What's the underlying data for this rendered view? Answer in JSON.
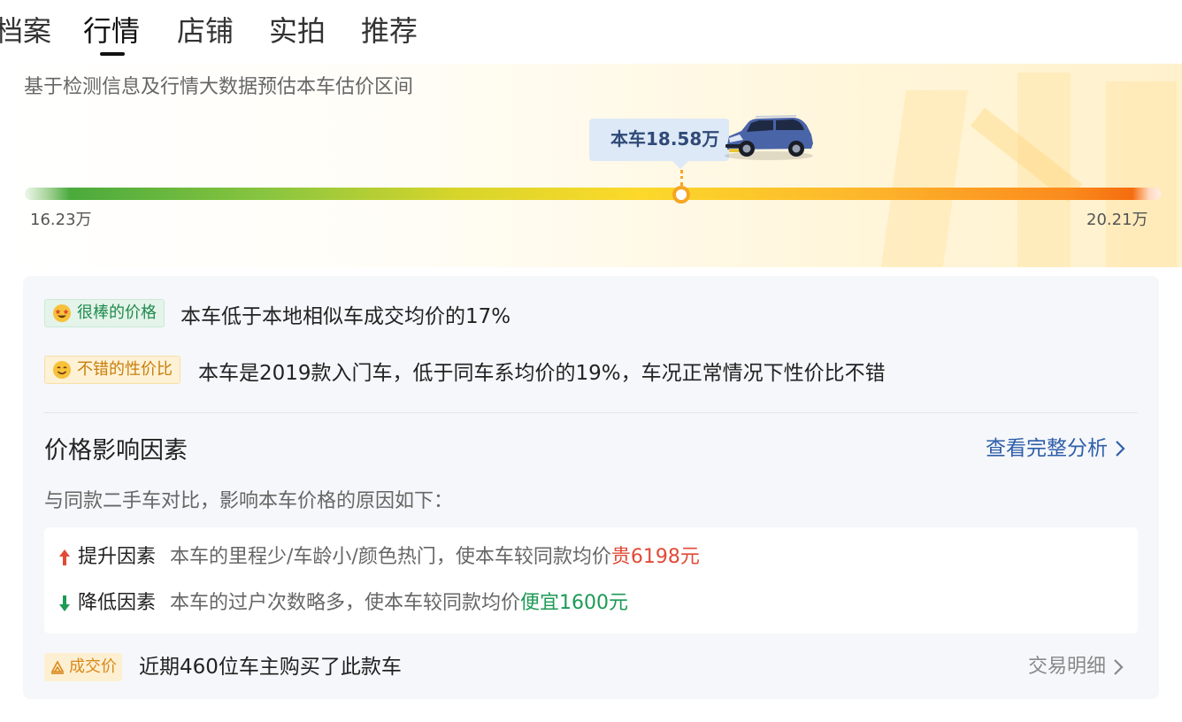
{
  "tabs": [
    {
      "label": "档案",
      "active": false
    },
    {
      "label": "行情",
      "active": true
    },
    {
      "label": "店铺",
      "active": false
    },
    {
      "label": "实拍",
      "active": false
    },
    {
      "label": "推荐",
      "active": false
    }
  ],
  "estimate": {
    "subtitle": "基于检测信息及行情大数据预估本车估价区间",
    "car_price": "本车18.58万",
    "range_low": "16.23万",
    "range_high": "20.21万",
    "position_fraction": 0.5905
  },
  "analysis": {
    "items": [
      {
        "tag": "很棒的价格",
        "icon": "star-struck-emoji-icon",
        "text": "本车低于本地相似车成交均价的17%"
      },
      {
        "tag": "不错的性价比",
        "icon": "smile-emoji-icon",
        "text": "本车是2019款入门车，低于同车系均价的19%，车况正常情况下性价比不错"
      }
    ]
  },
  "factors": {
    "title": "价格影响因素",
    "link": "查看完整分析",
    "desc": "与同款二手车对比，影响本车价格的原因如下：",
    "up": {
      "label": "提升因素",
      "text": "本车的里程少/车龄小/颜色热门，使本车较同款均价",
      "amount": "贵6198元"
    },
    "down": {
      "label": "降低因素",
      "text": "本车的过户次数略多，使本车较同款均价",
      "amount": "便宜1600元"
    }
  },
  "deal": {
    "tag": "成交价",
    "text": "近期460位车主购买了此款车",
    "link": "交易明细"
  },
  "colors": {
    "up": "#e24a36",
    "down": "#1d9a56",
    "link": "#2e5faa",
    "marker": "#f5a623"
  }
}
